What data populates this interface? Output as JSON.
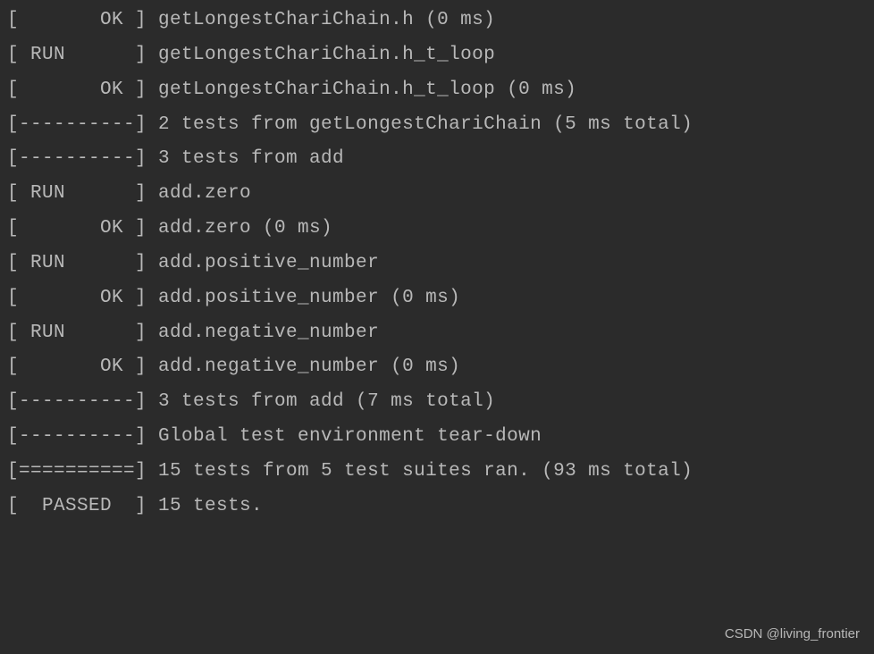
{
  "lines": [
    "[       OK ] getLongestChariChain.h (0 ms)",
    "[ RUN      ] getLongestChariChain.h_t_loop",
    "[       OK ] getLongestChariChain.h_t_loop (0 ms)",
    "[----------] 2 tests from getLongestChariChain (5 ms total)",
    "",
    "[----------] 3 tests from add",
    "[ RUN      ] add.zero",
    "[       OK ] add.zero (0 ms)",
    "[ RUN      ] add.positive_number",
    "[       OK ] add.positive_number (0 ms)",
    "[ RUN      ] add.negative_number",
    "[       OK ] add.negative_number (0 ms)",
    "[----------] 3 tests from add (7 ms total)",
    "",
    "[----------] Global test environment tear-down",
    "[==========] 15 tests from 5 test suites ran. (93 ms total)",
    "[  PASSED  ] 15 tests."
  ],
  "watermark": "CSDN @living_frontier"
}
